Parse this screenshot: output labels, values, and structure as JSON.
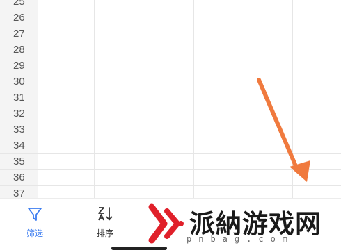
{
  "sheet": {
    "row_numbers": [
      "25",
      "26",
      "27",
      "28",
      "29",
      "30",
      "31",
      "32",
      "33",
      "34",
      "35",
      "36",
      "37"
    ]
  },
  "toolbar": {
    "filter_label": "筛选",
    "sort_label": "排序",
    "accent_color": "#3b7cf0"
  },
  "overlay": {
    "arrow_color": "#f07a3e"
  },
  "watermark": {
    "title": "派納游戏网",
    "subtitle": "pnbag.com"
  }
}
